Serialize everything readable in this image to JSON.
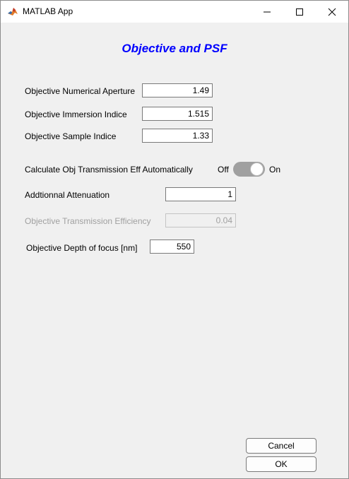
{
  "window": {
    "title": "MATLAB App"
  },
  "heading": "Objective and PSF",
  "fields": {
    "na": {
      "label": "Objective Numerical Aperture",
      "value": "1.49"
    },
    "immersion": {
      "label": "Objective Immersion Indice",
      "value": "1.515"
    },
    "sample": {
      "label": "Objective Sample Indice",
      "value": "1.33"
    },
    "attenuation": {
      "label": "Addtionnal Attenuation",
      "value": "1"
    },
    "transmission": {
      "label": "Objective Transmission Efficiency",
      "value": "0.04"
    },
    "depth": {
      "label": "Objective Depth of focus [nm]",
      "value": "550"
    }
  },
  "switch": {
    "label": "Calculate Obj Transmission Eff Automatically",
    "off": "Off",
    "on": "On",
    "state": "on"
  },
  "buttons": {
    "cancel": "Cancel",
    "ok": "OK"
  },
  "icons": {
    "app": "matlab-icon",
    "minimize": "minimize-icon",
    "maximize": "maximize-icon",
    "close": "close-icon"
  }
}
